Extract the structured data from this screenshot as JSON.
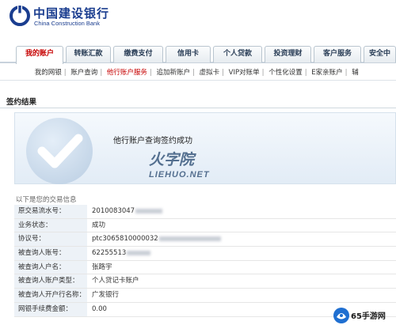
{
  "header": {
    "brand_cn": "中国建设银行",
    "brand_en": "China Construction Bank",
    "logo_icon": "ccb-logo-icon"
  },
  "tabs": [
    {
      "label": "我的账户",
      "active": true
    },
    {
      "label": "转账汇款",
      "active": false
    },
    {
      "label": "缴费支付",
      "active": false
    },
    {
      "label": "信用卡",
      "active": false
    },
    {
      "label": "个人贷款",
      "active": false
    },
    {
      "label": "投资理财",
      "active": false
    },
    {
      "label": "客户服务",
      "active": false
    },
    {
      "label": "安全中",
      "active": false
    }
  ],
  "subnav": [
    {
      "label": "我的网银",
      "current": false
    },
    {
      "label": "账户查询",
      "current": false
    },
    {
      "label": "他行账户服务",
      "current": true
    },
    {
      "label": "追加新账户",
      "current": false
    },
    {
      "label": "虚拟卡",
      "current": false
    },
    {
      "label": "VIP对账单",
      "current": false
    },
    {
      "label": "个性化设置",
      "current": false
    },
    {
      "label": "E家亲账户",
      "current": false
    },
    {
      "label": "辅",
      "current": false
    }
  ],
  "section_title": "签约结果",
  "success": {
    "icon": "check-icon",
    "message": "他行账户查询签约成功"
  },
  "watermark": {
    "cn": "火字院",
    "en": "LIEHUO.NET"
  },
  "info": {
    "title": "以下是您的交易信息",
    "rows": [
      {
        "label": "原交易流水号：",
        "value": "2010083047"
      },
      {
        "label": "业务状态：",
        "value": "成功"
      },
      {
        "label": "协议号：",
        "value": "ptc3065810000032"
      },
      {
        "label": "被查询人账号：",
        "value": "62255513"
      },
      {
        "label": "被查询人户名：",
        "value": "张路宇"
      },
      {
        "label": "被查询人账户类型：",
        "value": "个人贷记卡账户"
      },
      {
        "label": "被查询人开户行名称：",
        "value": "广发银行"
      },
      {
        "label": "网银手续费金额：",
        "value": "0.00"
      }
    ]
  },
  "badge": {
    "text": "65手游网",
    "icon": "game-controller-icon"
  },
  "colors": {
    "brand_blue": "#1a3d8f",
    "active_red": "#c60000",
    "label_bg": "#edf2f7"
  }
}
